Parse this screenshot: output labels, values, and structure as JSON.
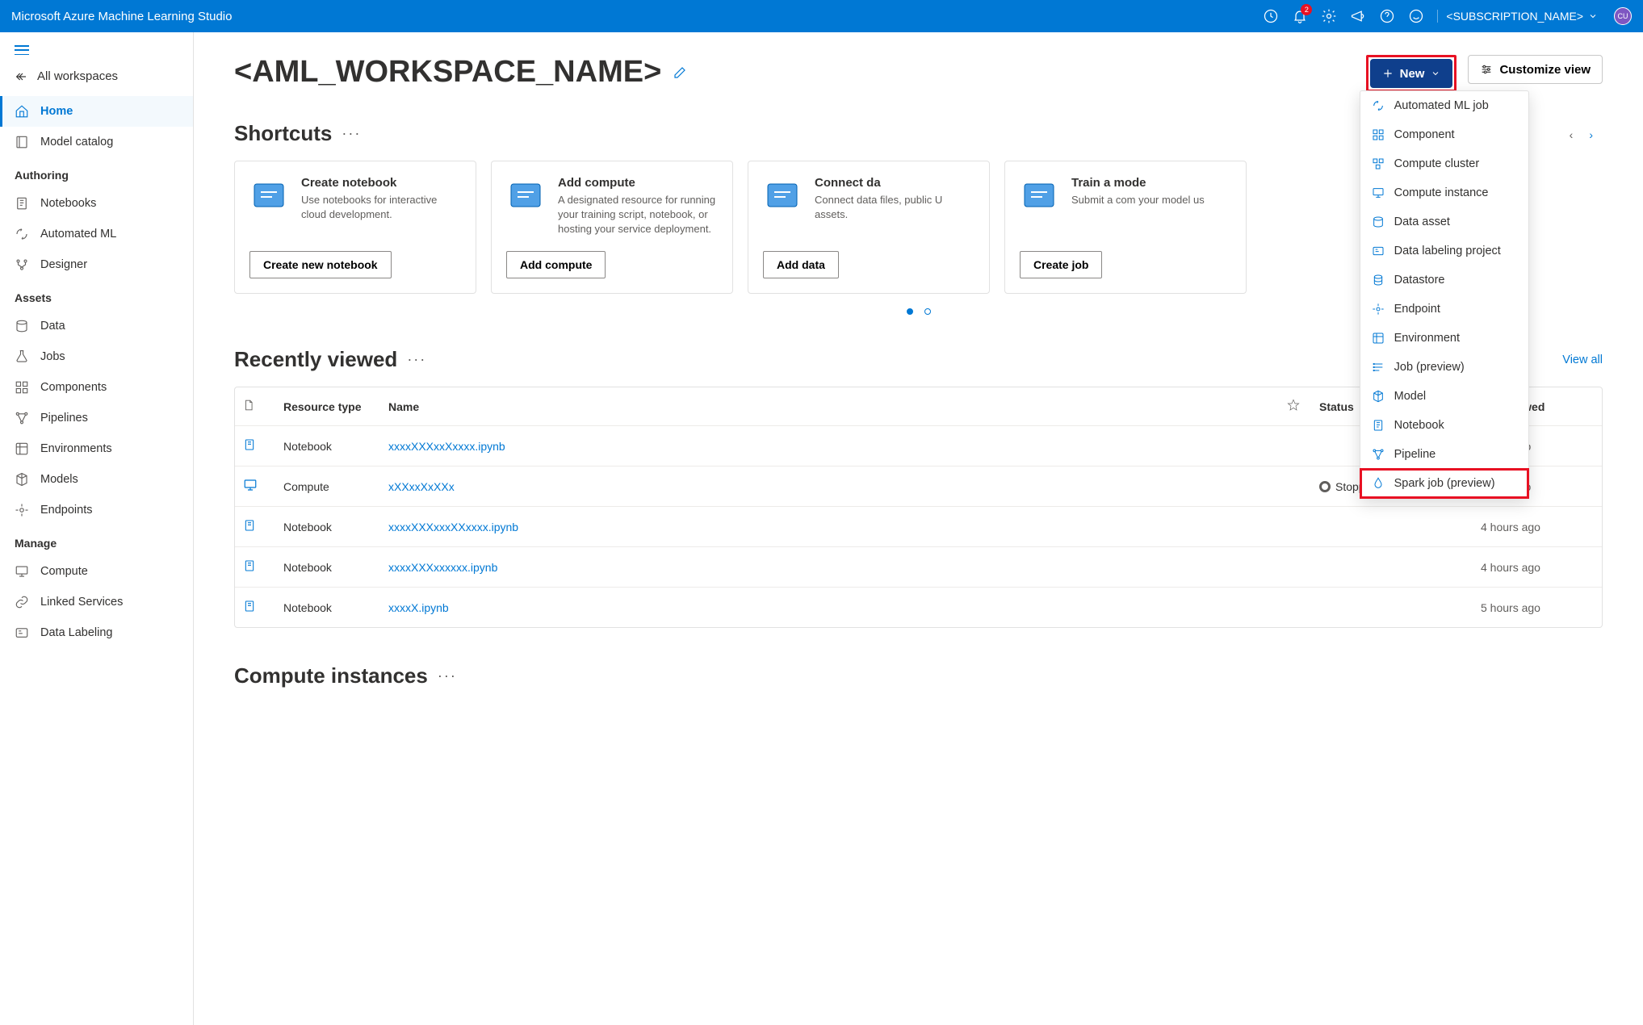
{
  "topbar": {
    "brand": "Microsoft Azure Machine Learning Studio",
    "notification_count": "2",
    "subscription": "<SUBSCRIPTION_NAME>",
    "avatar_initials": "CU"
  },
  "sidebar": {
    "back_label": "All workspaces",
    "sections": [
      {
        "items": [
          {
            "label": "Home",
            "icon": "home",
            "active": true
          },
          {
            "label": "Model catalog",
            "icon": "book"
          }
        ]
      },
      {
        "header": "Authoring",
        "items": [
          {
            "label": "Notebooks",
            "icon": "notebook"
          },
          {
            "label": "Automated ML",
            "icon": "auto"
          },
          {
            "label": "Designer",
            "icon": "designer"
          }
        ]
      },
      {
        "header": "Assets",
        "items": [
          {
            "label": "Data",
            "icon": "data"
          },
          {
            "label": "Jobs",
            "icon": "flask"
          },
          {
            "label": "Components",
            "icon": "component"
          },
          {
            "label": "Pipelines",
            "icon": "pipeline"
          },
          {
            "label": "Environments",
            "icon": "env"
          },
          {
            "label": "Models",
            "icon": "model"
          },
          {
            "label": "Endpoints",
            "icon": "endpoint"
          }
        ]
      },
      {
        "header": "Manage",
        "items": [
          {
            "label": "Compute",
            "icon": "compute"
          },
          {
            "label": "Linked Services",
            "icon": "link"
          },
          {
            "label": "Data Labeling",
            "icon": "label"
          }
        ]
      }
    ]
  },
  "page": {
    "workspace_name": "<AML_WORKSPACE_NAME>",
    "new_button": "New",
    "customize_button": "Customize view",
    "new_dropdown": [
      {
        "label": "Automated ML job",
        "icon": "auto"
      },
      {
        "label": "Component",
        "icon": "component"
      },
      {
        "label": "Compute cluster",
        "icon": "cluster"
      },
      {
        "label": "Compute instance",
        "icon": "compute"
      },
      {
        "label": "Data asset",
        "icon": "data"
      },
      {
        "label": "Data labeling project",
        "icon": "label"
      },
      {
        "label": "Datastore",
        "icon": "datastore"
      },
      {
        "label": "Endpoint",
        "icon": "endpoint"
      },
      {
        "label": "Environment",
        "icon": "env"
      },
      {
        "label": "Job (preview)",
        "icon": "job"
      },
      {
        "label": "Model",
        "icon": "model"
      },
      {
        "label": "Notebook",
        "icon": "notebook"
      },
      {
        "label": "Pipeline",
        "icon": "pipeline"
      },
      {
        "label": "Spark job (preview)",
        "icon": "spark",
        "highlight": true
      }
    ]
  },
  "shortcuts": {
    "title": "Shortcuts",
    "cards": [
      {
        "title": "Create notebook",
        "desc": "Use notebooks for interactive cloud development.",
        "button": "Create new notebook",
        "icon": "notebook"
      },
      {
        "title": "Add compute",
        "desc": "A designated resource for running your training script, notebook, or hosting your service deployment.",
        "button": "Add compute",
        "icon": "compute"
      },
      {
        "title": "Connect da",
        "desc": "Connect data files, public U assets.",
        "button": "Add data",
        "icon": "connect"
      },
      {
        "title": "Train a mode",
        "desc": "Submit a com your model us",
        "button": "Create job",
        "icon": "train"
      }
    ]
  },
  "recent": {
    "title": "Recently viewed",
    "view_all": "View all",
    "columns": {
      "type": "Resource type",
      "name": "Name",
      "status": "Status",
      "last": "Last viewed"
    },
    "rows": [
      {
        "icon": "notebook",
        "type": "Notebook",
        "name": "xxxxXXXxxXxxxx.ipynb",
        "status": "",
        "last": "hours ago"
      },
      {
        "icon": "compute",
        "type": "Compute",
        "name": "xXXxxXxXXx",
        "status": "Stopped",
        "last": "hours ago"
      },
      {
        "icon": "notebook",
        "type": "Notebook",
        "name": "xxxxXXXxxxXXxxxx.ipynb",
        "status": "",
        "last": "4 hours ago"
      },
      {
        "icon": "notebook",
        "type": "Notebook",
        "name": "xxxxXXXxxxxxx.ipynb",
        "status": "",
        "last": "4 hours ago"
      },
      {
        "icon": "notebook",
        "type": "Notebook",
        "name": "xxxxX.ipynb",
        "status": "",
        "last": "5 hours ago"
      }
    ]
  },
  "compute_instances": {
    "title": "Compute instances"
  }
}
